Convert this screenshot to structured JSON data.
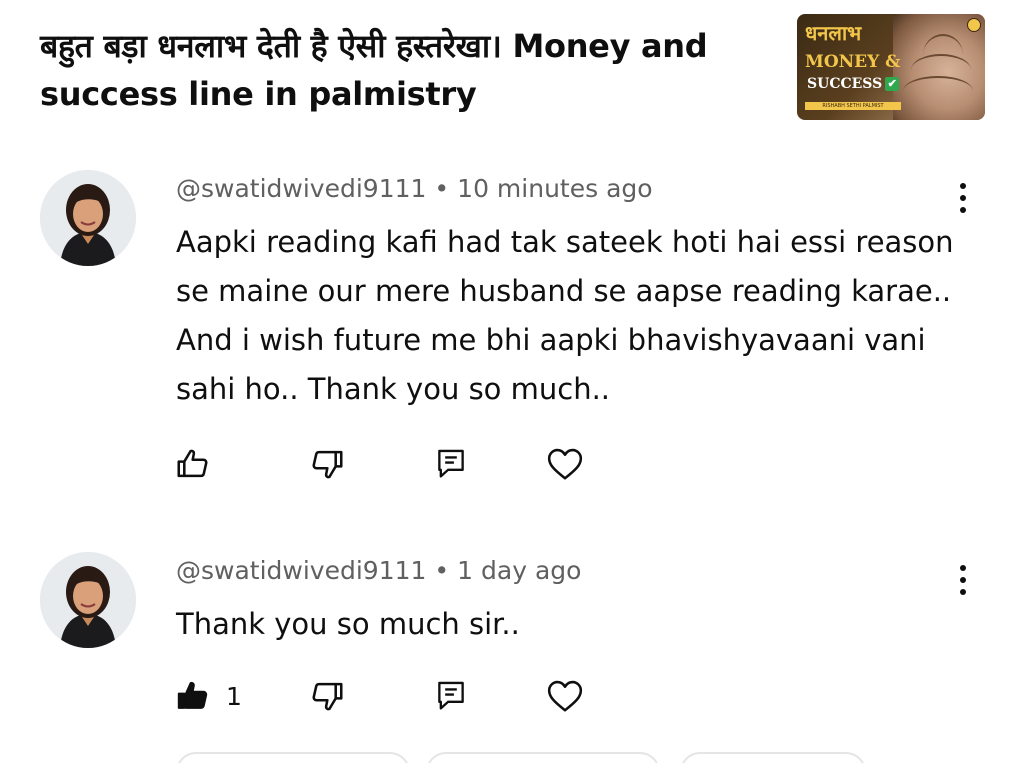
{
  "video": {
    "title": "बहुत बड़ा धनलाभ देती है ऐसी हस्तरेखा। Money and success line in palmistry",
    "thumbnail": {
      "line1": "धनलाभ",
      "line2": "MONEY &",
      "line3": "SUCCESS",
      "check": "✔",
      "channel": "RISHABH SETHI PALMIST"
    }
  },
  "comments": [
    {
      "author": "@swatidwivedi9111",
      "separator": "•",
      "time": "10 minutes ago",
      "text": "Aapki reading kafi had tak sateek hoti hai essi reason se maine our mere husband se aapse reading karae.. And i wish future me bhi aapki bhavishyavaani vani sahi ho.. Thank you so much..",
      "like_count": "",
      "liked": false
    },
    {
      "author": "@swatidwivedi9111",
      "separator": "•",
      "time": "1 day ago",
      "text": "Thank you so much sir..",
      "like_count": "1",
      "liked": true
    }
  ],
  "icons": {
    "like": "thumb-up-icon",
    "dislike": "thumb-down-icon",
    "reply": "reply-icon",
    "heart": "heart-icon",
    "more": "more-vert-icon"
  },
  "colors": {
    "text": "#0f0f0f",
    "meta": "#606060",
    "thumb_gold": "#f2c64b"
  }
}
